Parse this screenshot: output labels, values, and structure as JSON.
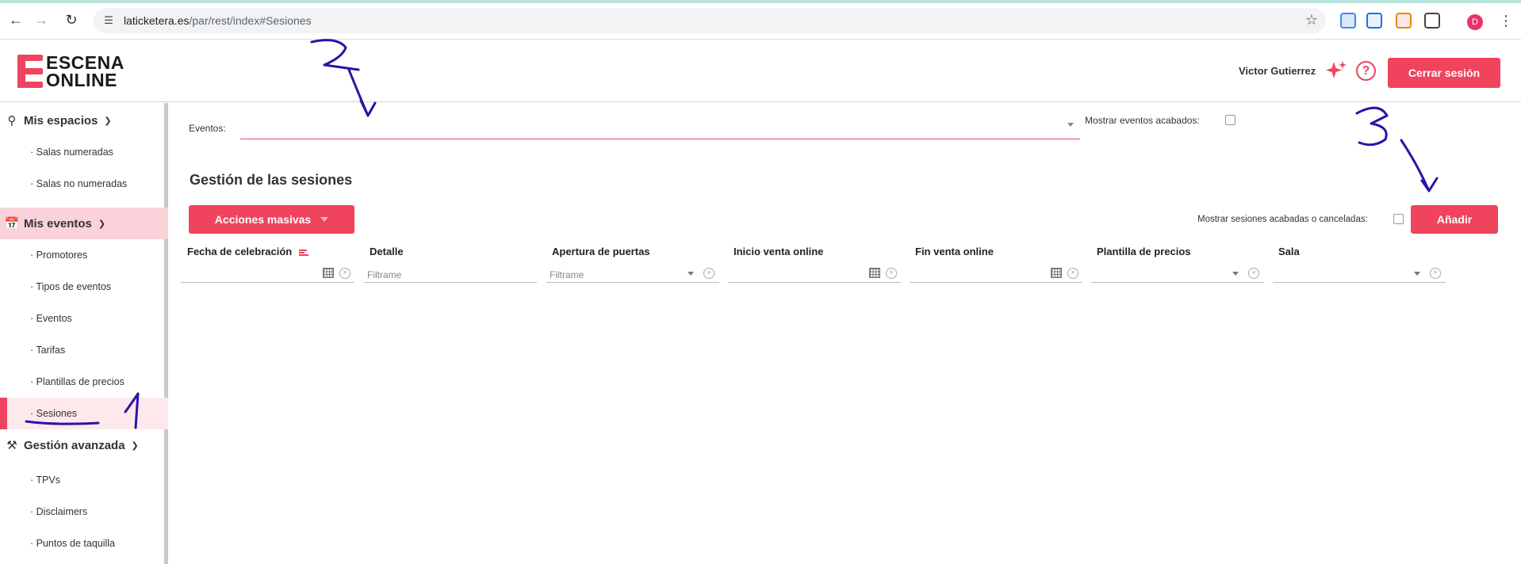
{
  "browser": {
    "url_host": "laticketera.es",
    "url_path": "/par/rest/index#Sesiones",
    "profile_initial": "D"
  },
  "header": {
    "logo_line1": "ESCENA",
    "logo_line2": "ONLINE",
    "user_name": "Victor Gutierrez",
    "help_glyph": "?",
    "logout_label": "Cerrar sesión"
  },
  "sidebar": {
    "sections": [
      {
        "label": "Mis espacios",
        "icon": "location-pin-icon",
        "items": [
          "· Salas numeradas",
          "· Salas no numeradas"
        ]
      },
      {
        "label": "Mis eventos",
        "icon": "calendar-icon",
        "active": true,
        "items": [
          "· Promotores",
          "· Tipos de eventos",
          "· Eventos",
          "· Tarifas",
          "· Plantillas de precios",
          "· Sesiones"
        ]
      },
      {
        "label": "Gestión avanzada",
        "icon": "tools-icon",
        "items": [
          "· TPVs",
          "· Disclaimers",
          "· Puntos de taquilla"
        ]
      }
    ],
    "active_item": "· Sesiones"
  },
  "main": {
    "events_label": "Eventos:",
    "events_value": "",
    "show_ended_label": "Mostrar eventos acabados:",
    "show_ended_checked": false,
    "title": "Gestión de las sesiones",
    "mass_actions_label": "Acciones masivas",
    "show_sessions_label": "Mostrar sesiones acabadas o canceladas:",
    "show_sessions_checked": false,
    "add_label": "Añadir",
    "columns": [
      {
        "label": "Fecha de celebración",
        "filter": "date",
        "placeholder": ""
      },
      {
        "label": "Detalle",
        "filter": "text",
        "placeholder": "Filtrame"
      },
      {
        "label": "Apertura de puertas",
        "filter": "select",
        "placeholder": "Filtrame"
      },
      {
        "label": "Inicio venta online",
        "filter": "date",
        "placeholder": ""
      },
      {
        "label": "Fin venta online",
        "filter": "date",
        "placeholder": ""
      },
      {
        "label": "Plantilla de precios",
        "filter": "select",
        "placeholder": ""
      },
      {
        "label": "Sala",
        "filter": "select",
        "placeholder": ""
      }
    ]
  },
  "annotations": {
    "marks": [
      "1",
      "2",
      "3"
    ],
    "color": "#2a14a8"
  },
  "colors": {
    "accent": "#f0435d",
    "active_section_bg": "#fbd2d9",
    "active_item_bg": "#fde8ec"
  }
}
